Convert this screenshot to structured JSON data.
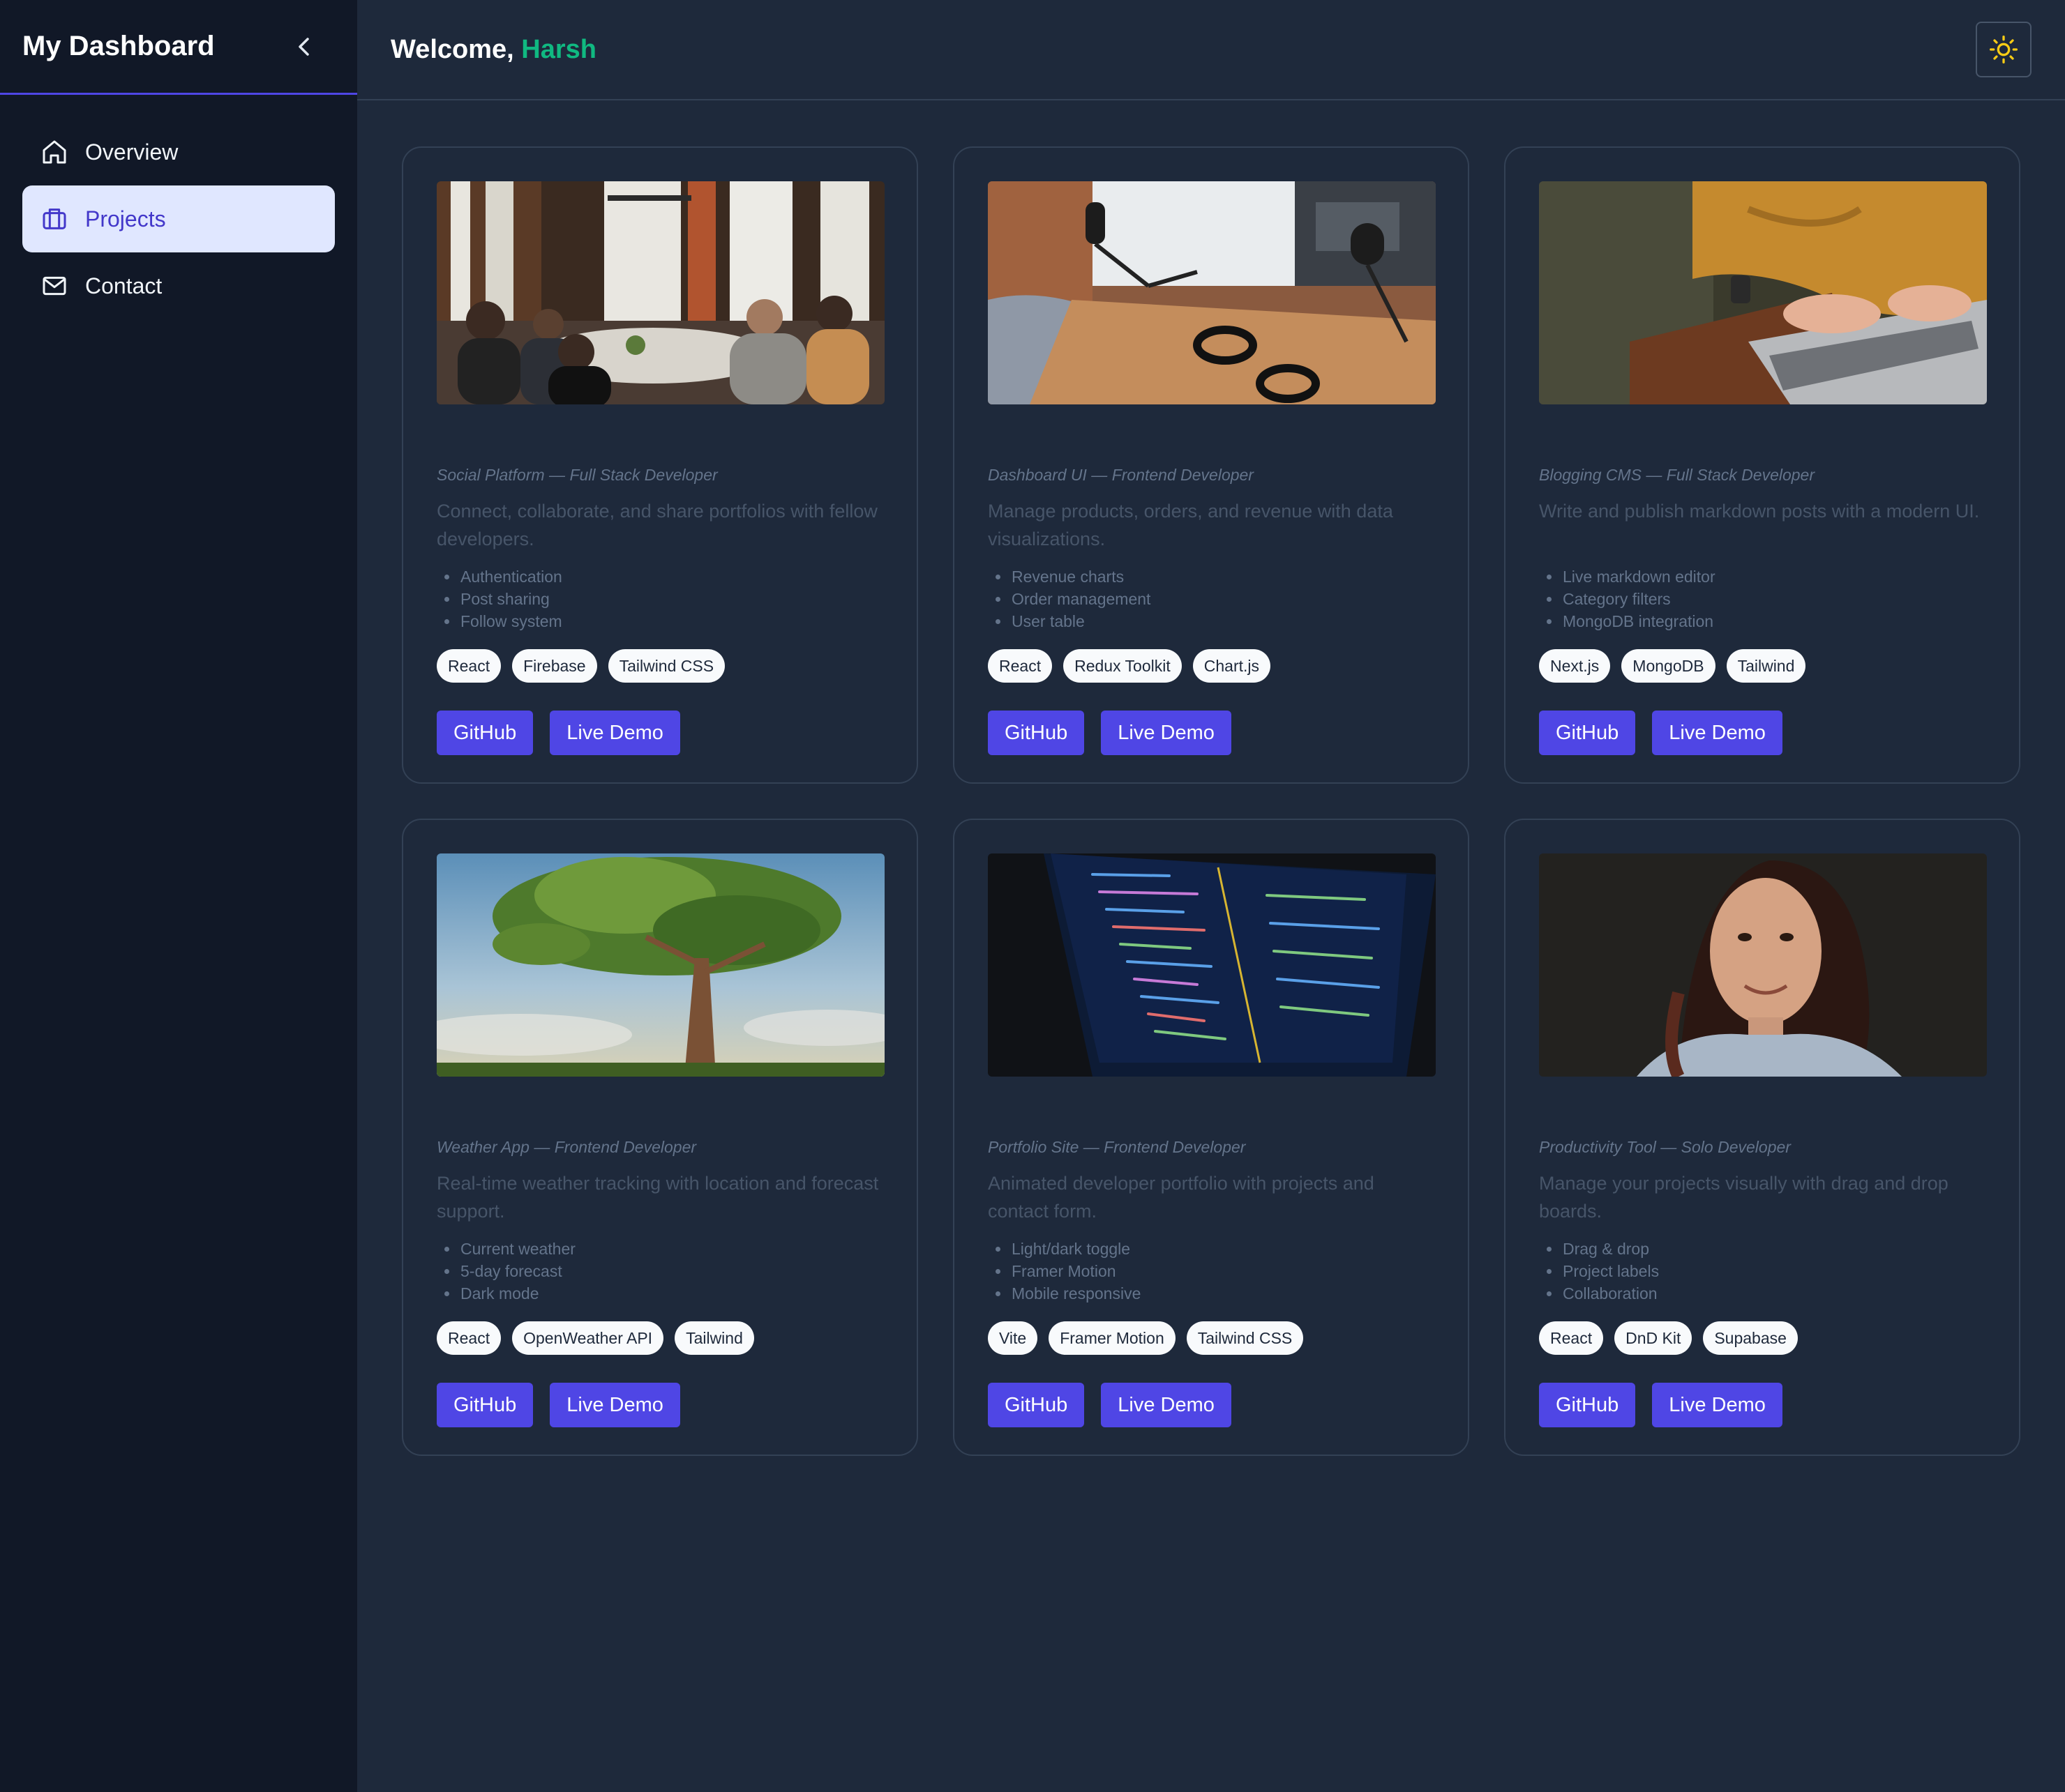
{
  "sidebar": {
    "title": "My Dashboard",
    "collapse_icon": "chevron-left-icon",
    "items": [
      {
        "label": "Overview",
        "icon": "home-icon",
        "active": false
      },
      {
        "label": "Projects",
        "icon": "briefcase-icon",
        "active": true
      },
      {
        "label": "Contact",
        "icon": "mail-icon",
        "active": false
      }
    ]
  },
  "header": {
    "greeting": "Welcome,",
    "user_name": "Harsh",
    "theme_icon": "sun-icon"
  },
  "colors": {
    "accent": "#4f46e5",
    "user_name": "#10b981",
    "sun": "#facc15",
    "active_nav_bg": "#e0e7ff"
  },
  "projects": [
    {
      "image": "team-meeting-photo",
      "meta": "Social Platform — Full Stack Developer",
      "description": "Connect, collaborate, and share portfolios with fellow developers.",
      "features": [
        "Authentication",
        "Post sharing",
        "Follow system"
      ],
      "tags": [
        "React",
        "Firebase",
        "Tailwind CSS"
      ],
      "github_label": "GitHub",
      "demo_label": "Live Demo"
    },
    {
      "image": "podcast-studio-photo",
      "meta": "Dashboard UI — Frontend Developer",
      "description": "Manage products, orders, and revenue with data visualizations.",
      "features": [
        "Revenue charts",
        "Order management",
        "User table"
      ],
      "tags": [
        "React",
        "Redux Toolkit",
        "Chart.js"
      ],
      "github_label": "GitHub",
      "demo_label": "Live Demo"
    },
    {
      "image": "typing-laptop-photo",
      "meta": "Blogging CMS — Full Stack Developer",
      "description": "Write and publish markdown posts with a modern UI.",
      "features": [
        "Live markdown editor",
        "Category filters",
        "MongoDB integration"
      ],
      "tags": [
        "Next.js",
        "MongoDB",
        "Tailwind"
      ],
      "github_label": "GitHub",
      "demo_label": "Live Demo"
    },
    {
      "image": "tree-sky-photo",
      "meta": "Weather App — Frontend Developer",
      "description": "Real-time weather tracking with location and forecast support.",
      "features": [
        "Current weather",
        "5-day forecast",
        "Dark mode"
      ],
      "tags": [
        "React",
        "OpenWeather API",
        "Tailwind"
      ],
      "github_label": "GitHub",
      "demo_label": "Live Demo"
    },
    {
      "image": "code-screen-photo",
      "meta": "Portfolio Site — Frontend Developer",
      "description": "Animated developer portfolio with projects and contact form.",
      "features": [
        "Light/dark toggle",
        "Framer Motion",
        "Mobile responsive"
      ],
      "tags": [
        "Vite",
        "Framer Motion",
        "Tailwind CSS"
      ],
      "github_label": "GitHub",
      "demo_label": "Live Demo"
    },
    {
      "image": "portrait-woman-photo",
      "meta": "Productivity Tool — Solo Developer",
      "description": "Manage your projects visually with drag and drop boards.",
      "features": [
        "Drag & drop",
        "Project labels",
        "Collaboration"
      ],
      "tags": [
        "React",
        "DnD Kit",
        "Supabase"
      ],
      "github_label": "GitHub",
      "demo_label": "Live Demo"
    }
  ]
}
